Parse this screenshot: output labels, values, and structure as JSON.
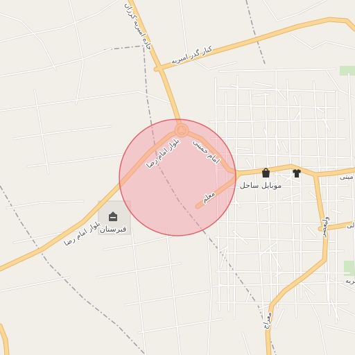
{
  "map": {
    "colors": {
      "background": "#f2efe9",
      "minor_road": "#ffffff",
      "minor_road_casing": "#d6d1c8",
      "main_road": "#fbd796",
      "main_road_casing": "#e8b56a",
      "boundary": "#9e9aa6",
      "park": "#cfe7c2",
      "marker_fill": "#f59aa3",
      "marker_stroke": "#e06470"
    },
    "roads": {
      "imam_reza_sw": "بلوار امام رضا",
      "imam_reza_ne": "بلوار امام رضا",
      "kenar_gozar": "کنار گذر امیریه",
      "jadeh_amirieh": "جاده امیریه کرزان",
      "imam_khomeini": "امام خمینی",
      "moallem": "معلم",
      "meraj": "معراج",
      "valiasr": "ولیعصر",
      "amirieh_partial": "امیریه",
      "east_partial": "میتی",
      "far_east_partial": "لی"
    },
    "pois": {
      "cemetery": {
        "label": "قبرستان",
        "icon": "cemetery-icon"
      },
      "shop": {
        "label": "موبایل ساحل",
        "icon": "shopping-bag-icon"
      },
      "clothes": {
        "icon": "shirt-icon"
      }
    }
  }
}
